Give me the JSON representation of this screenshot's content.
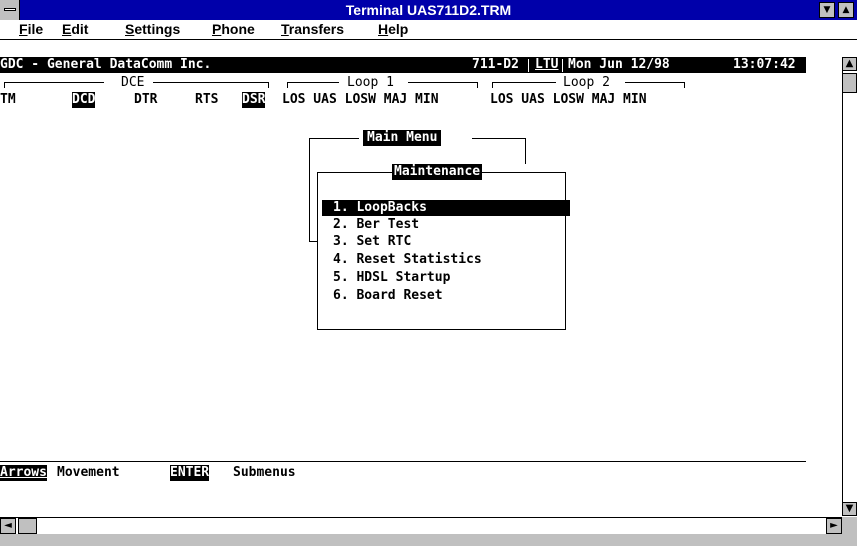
{
  "window": {
    "title": "Terminal UAS711D2.TRM",
    "minimize_glyph": "▼",
    "restore_glyph": "▲"
  },
  "menubar": {
    "items": [
      {
        "u": "F",
        "rest": "ile"
      },
      {
        "u": "E",
        "rest": "dit"
      },
      {
        "u": "S",
        "rest": "ettings"
      },
      {
        "u": "P",
        "rest": "hone"
      },
      {
        "u": "T",
        "rest": "ransfers"
      },
      {
        "u": "H",
        "rest": "elp"
      }
    ]
  },
  "terminal": {
    "header": {
      "company": "GDC - General DataComm Inc.",
      "model": "711-D2",
      "unit": "LTU",
      "date": "Mon Jun 12/98",
      "time": "13:07:42"
    },
    "groups": {
      "dce": "DCE",
      "loop1": "Loop 1",
      "loop2": "Loop 2"
    },
    "indicators": {
      "tm": "TM",
      "dcd": "DCD",
      "dtr": "DTR",
      "rts": "RTS",
      "dsr": "DSR",
      "loop1": "LOS UAS LOSW MAJ MIN",
      "loop2": "LOS UAS LOSW MAJ MIN"
    },
    "main_menu_title": "Main Menu",
    "submenu_title": "Maintenance",
    "menu_items": [
      "1. LoopBacks",
      "2. Ber Test",
      "3. Set RTC",
      "4. Reset Statistics",
      "5. HDSL Startup",
      "6. Board Reset"
    ],
    "selected_index": 0,
    "footer": {
      "key1": "Arrows",
      "text1": "Movement",
      "key2": "ENTER",
      "text2": "Submenus"
    }
  },
  "scrollbars": {
    "left_arrow": "◄",
    "right_arrow": "►",
    "up_arrow": "▲",
    "down_arrow": "▼"
  }
}
